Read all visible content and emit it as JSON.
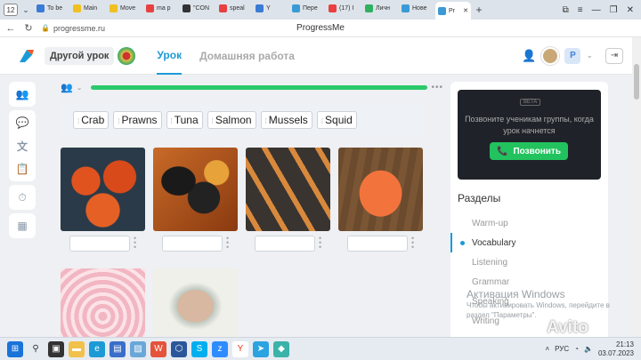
{
  "browser": {
    "tab_count": "12",
    "tabs": [
      {
        "label": "To be",
        "color": "#3a7bd5"
      },
      {
        "label": "Main",
        "color": "#f0c020"
      },
      {
        "label": "Move",
        "color": "#f0c020"
      },
      {
        "label": "ma p",
        "color": "#e84040"
      },
      {
        "label": "\"CON",
        "color": "#333333"
      },
      {
        "label": "speal",
        "color": "#e84040"
      },
      {
        "label": "Y",
        "color": "#3a7bd5"
      },
      {
        "label": "Пере",
        "color": "#3a9ad5"
      },
      {
        "label": "(17) I",
        "color": "#e84040"
      },
      {
        "label": "Личн",
        "color": "#30b060"
      },
      {
        "label": "Нове",
        "color": "#3a9ad5"
      },
      {
        "label": "Pr",
        "color": "#3a9ad5"
      }
    ],
    "url": "progressme.ru",
    "page_title": "ProgressMe"
  },
  "header": {
    "other_lesson": "Другой урок",
    "tabs": [
      "Урок",
      "Домашняя работа"
    ],
    "user_badge": "P"
  },
  "exercise": {
    "words": [
      "Crab",
      "Prawns",
      "Tuna",
      "Salmon",
      "Mussels",
      "Squid"
    ],
    "images": [
      "crab-photo",
      "mussels-photo",
      "prawns-photo",
      "salmon-photo",
      "squid-photo",
      "tuna-photo"
    ],
    "progress": 1.0
  },
  "right_panel": {
    "beta": "BETA",
    "call_message": "Позвоните ученикам группы, когда урок начнется",
    "call_button": "Позвонить",
    "sections_title": "Разделы",
    "sections": [
      "Warm-up",
      "Vocabulary",
      "Listening",
      "Grammar",
      "Speaking",
      "Writing"
    ],
    "active_section": "Vocabulary"
  },
  "watermark": {
    "title": "Активация Windows",
    "text": "Чтобы активировать Windows, перейдите в раздел \"Параметры\"."
  },
  "overlay": "Avito",
  "taskbar": {
    "lang": "РУС",
    "time": "21:13",
    "date": "03.07.2023"
  },
  "colors": {
    "accent": "#1a9bd7",
    "progress": "#2bc96a",
    "call": "#22c35e"
  }
}
